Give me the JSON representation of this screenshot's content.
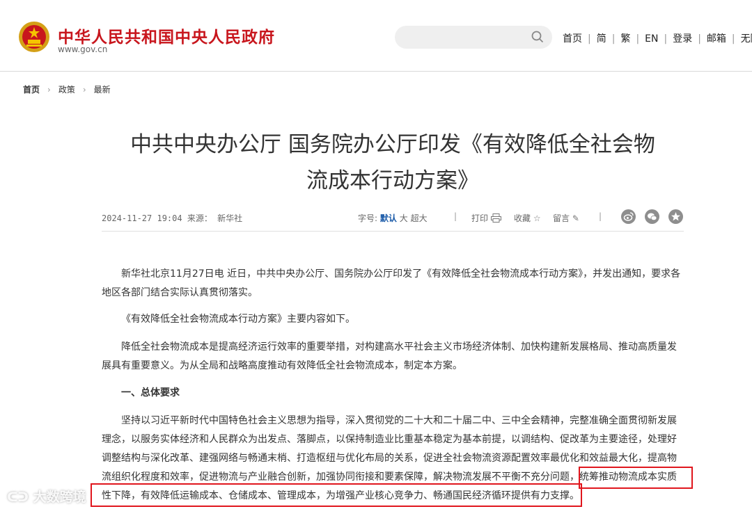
{
  "header": {
    "site_name": "中华人民共和国中央人民政府",
    "site_domain": "www.gov.cn",
    "search": {
      "placeholder": ""
    },
    "nav": [
      "首页",
      "简",
      "繁",
      "EN",
      "登录",
      "邮箱",
      "无障"
    ]
  },
  "breadcrumb": [
    "首页",
    "政策",
    "最新"
  ],
  "article": {
    "title_line1": "中共中央办公厅 国务院办公厅印发《有效降低全社会物",
    "title_line2": "流成本行动方案》",
    "meta": {
      "datetime": "2024-11-27 19:04",
      "source_label": "来源：",
      "source": "新华社",
      "font_label": "字号:",
      "font_sizes": [
        "默认",
        "大",
        "超大"
      ],
      "print_label": "打印",
      "favorite_label": "收藏",
      "comment_label": "留言"
    },
    "share_icons": [
      "weibo-icon",
      "wechat-icon",
      "star-icon"
    ],
    "paragraphs": [
      "新华社北京11月27日电 近日，中共中央办公厅、国务院办公厅印发了《有效降低全社会物流成本行动方案》，并发出通知，要求各地区各部门结合实际认真贯彻落实。",
      "《有效降低全社会物流成本行动方案》主要内容如下。",
      "降低全社会物流成本是提高经济运行效率的重要举措，对构建高水平社会主义市场经济体制、加快构建新发展格局、推动高质量发展具有重要意义。为从全局和战略高度推动有效降低全社会物流成本，制定本方案。"
    ],
    "section_heading": "一、总体要求",
    "last_paragraph_lines": [
      "坚持以习近平新时代中国特色社会主义思想为指导，深入贯彻党的二十大和二十届二中、三中全会精神，完整准确全面贯彻新发展",
      "理念，以服务实体经济和人民群众为出发点、落脚点，以保持制造业比重基本稳定为基本前提，以调结构、促改革为主要途径，处理好",
      "调整结构与深化改革、建强网络与畅通末梢、打造枢纽与优化布局的关系，促进全社会物流资源配置效率最优化和效益最大化，提高物",
      "流组织化程度和效率，促进物流与产业融合创新，加强协同衔接和要素保障，解决物流发展不平衡不充分问题，统筹推动物流成本实质",
      "性下降，有效降低运输成本、仓储成本、管理成本，为增强产业核心竞争力、畅通国民经济循环提供有力支撑。"
    ]
  },
  "watermark": "大数跨境",
  "colors": {
    "brand_red": "#c8161d",
    "highlight_red": "#e0161d",
    "link_blue": "#1a5aa8"
  }
}
